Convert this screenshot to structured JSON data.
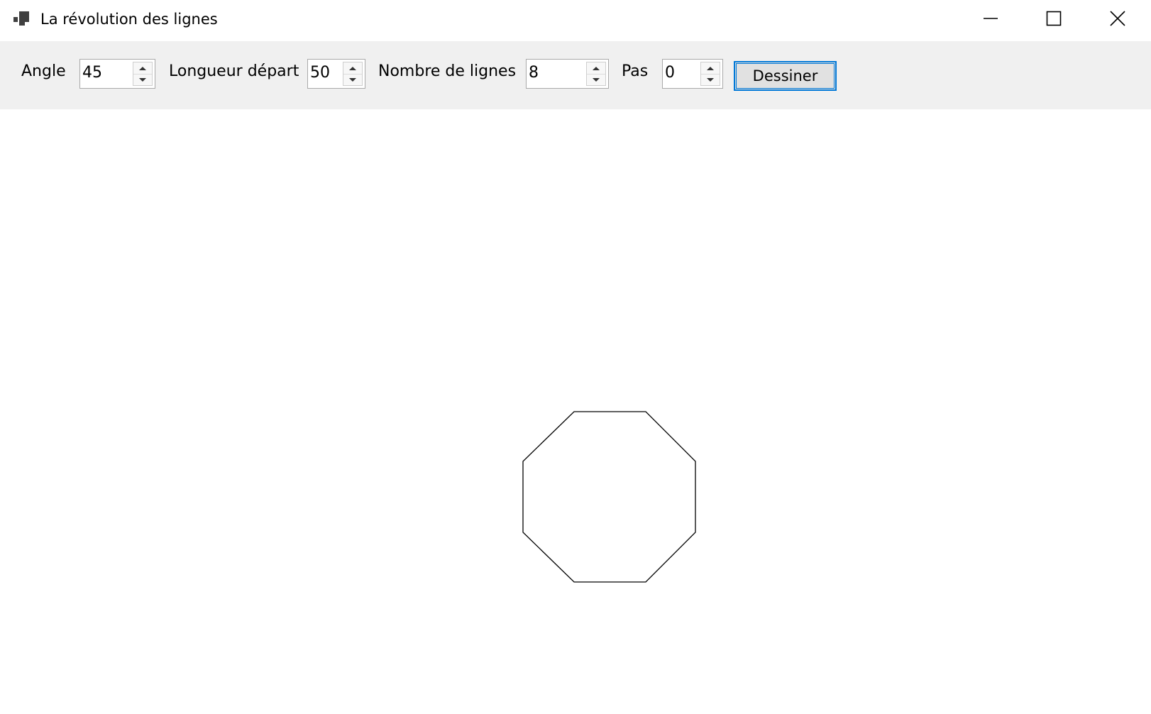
{
  "window": {
    "title": "La révolution des lignes",
    "app_icon": "app-window-icon"
  },
  "toolbar": {
    "angle_label": "Angle",
    "angle_value": "45",
    "length_label": "Longueur départ",
    "length_value": "50",
    "lines_label": "Nombre de lignes",
    "lines_value": "8",
    "step_label": "Pas",
    "step_value": "0",
    "draw_label": "Dessiner"
  },
  "drawing": {
    "shape": "octagon",
    "stroke_color": "#000000"
  },
  "colors": {
    "toolbar_bg": "#f0f0f0",
    "accent": "#0078d7",
    "canvas_bg": "#ffffff"
  }
}
